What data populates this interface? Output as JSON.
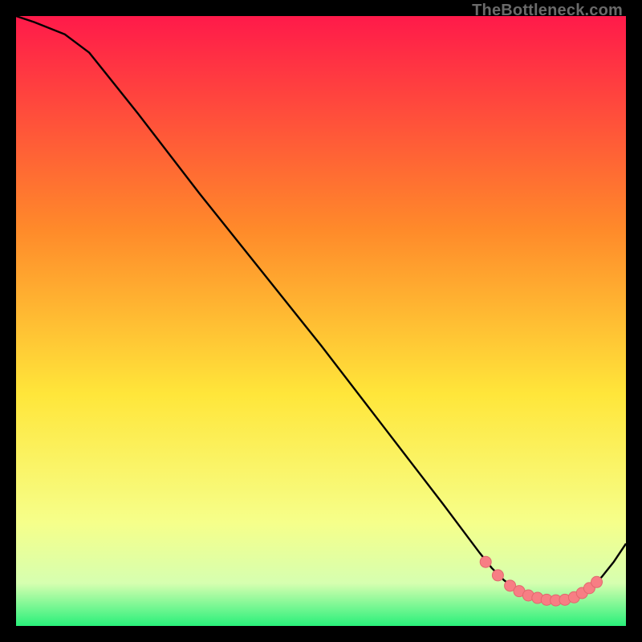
{
  "watermark": "TheBottleneck.com",
  "colors": {
    "bg_black": "#000000",
    "curve": "#000000",
    "marker_fill": "#f77e84",
    "marker_stroke": "#e2686e",
    "grad_top": "#ff1a4a",
    "grad_mid1": "#ff8a2a",
    "grad_mid2": "#ffe63a",
    "grad_low1": "#f6ff8a",
    "grad_low2": "#d6ffb0",
    "grad_bottom": "#29f07a"
  },
  "chart_data": {
    "type": "line",
    "title": "",
    "xlabel": "",
    "ylabel": "",
    "xlim": [
      0,
      100
    ],
    "ylim": [
      0,
      100
    ],
    "grid": false,
    "legend": false,
    "series": [
      {
        "name": "bottleneck-curve",
        "x": [
          0,
          3,
          8,
          12,
          20,
          30,
          40,
          50,
          60,
          70,
          76,
          78,
          80,
          82,
          84,
          86,
          88,
          90,
          92,
          94,
          96,
          98,
          100
        ],
        "y": [
          100,
          99,
          97,
          94,
          84,
          71,
          58.5,
          46,
          33,
          20,
          12,
          9.5,
          7.5,
          6,
          5,
          4.4,
          4.2,
          4.3,
          5,
          6.2,
          8,
          10.5,
          13.5
        ]
      }
    ],
    "markers": {
      "name": "optimal-region-dots",
      "x": [
        77,
        79,
        81,
        82.5,
        84,
        85.5,
        87,
        88.5,
        90,
        91.5,
        92.8,
        94,
        95.2
      ],
      "y": [
        10.5,
        8.3,
        6.6,
        5.7,
        5.0,
        4.6,
        4.3,
        4.2,
        4.3,
        4.7,
        5.4,
        6.2,
        7.2
      ]
    }
  }
}
